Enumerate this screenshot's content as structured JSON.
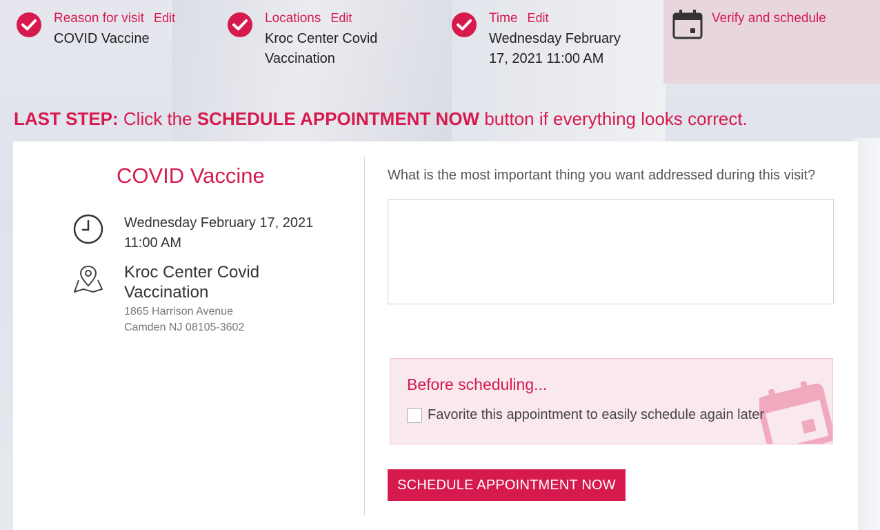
{
  "steps": [
    {
      "title": "Reason for visit",
      "edit": "Edit",
      "value": "COVID Vaccine"
    },
    {
      "title": "Locations",
      "edit": "Edit",
      "value": "Kroc Center Covid Vaccination"
    },
    {
      "title": "Time",
      "edit": "Edit",
      "value": "Wednesday February 17, 2021 11:00 AM"
    }
  ],
  "current_step": {
    "title": "Verify and schedule"
  },
  "instruction": {
    "lead": "LAST STEP:",
    "pre": " Click the ",
    "emphasis": "SCHEDULE APPOINTMENT NOW",
    "post": " button if everything looks correct."
  },
  "summary": {
    "visit_title": "COVID Vaccine",
    "date_line1": "Wednesday February 17, 2021",
    "date_line2": "11:00 AM",
    "location_name": "Kroc Center Covid Vaccination",
    "address_line1": "1865 Harrison Avenue",
    "address_line2": "Camden NJ 08105-3602"
  },
  "form": {
    "question": "What is the most important thing you want addressed during this visit?",
    "answer_value": "",
    "before_title": "Before scheduling...",
    "favorite_label": "Favorite this appointment to easily schedule again later",
    "favorite_checked": false,
    "schedule_button": "SCHEDULE APPOINTMENT NOW"
  },
  "colors": {
    "accent": "#d61a4e",
    "active_step_bg": "#e8d6de",
    "note_bg": "#f9e8ed"
  },
  "icons": [
    "check-icon",
    "calendar-icon",
    "clock-icon",
    "map-pin-icon"
  ]
}
